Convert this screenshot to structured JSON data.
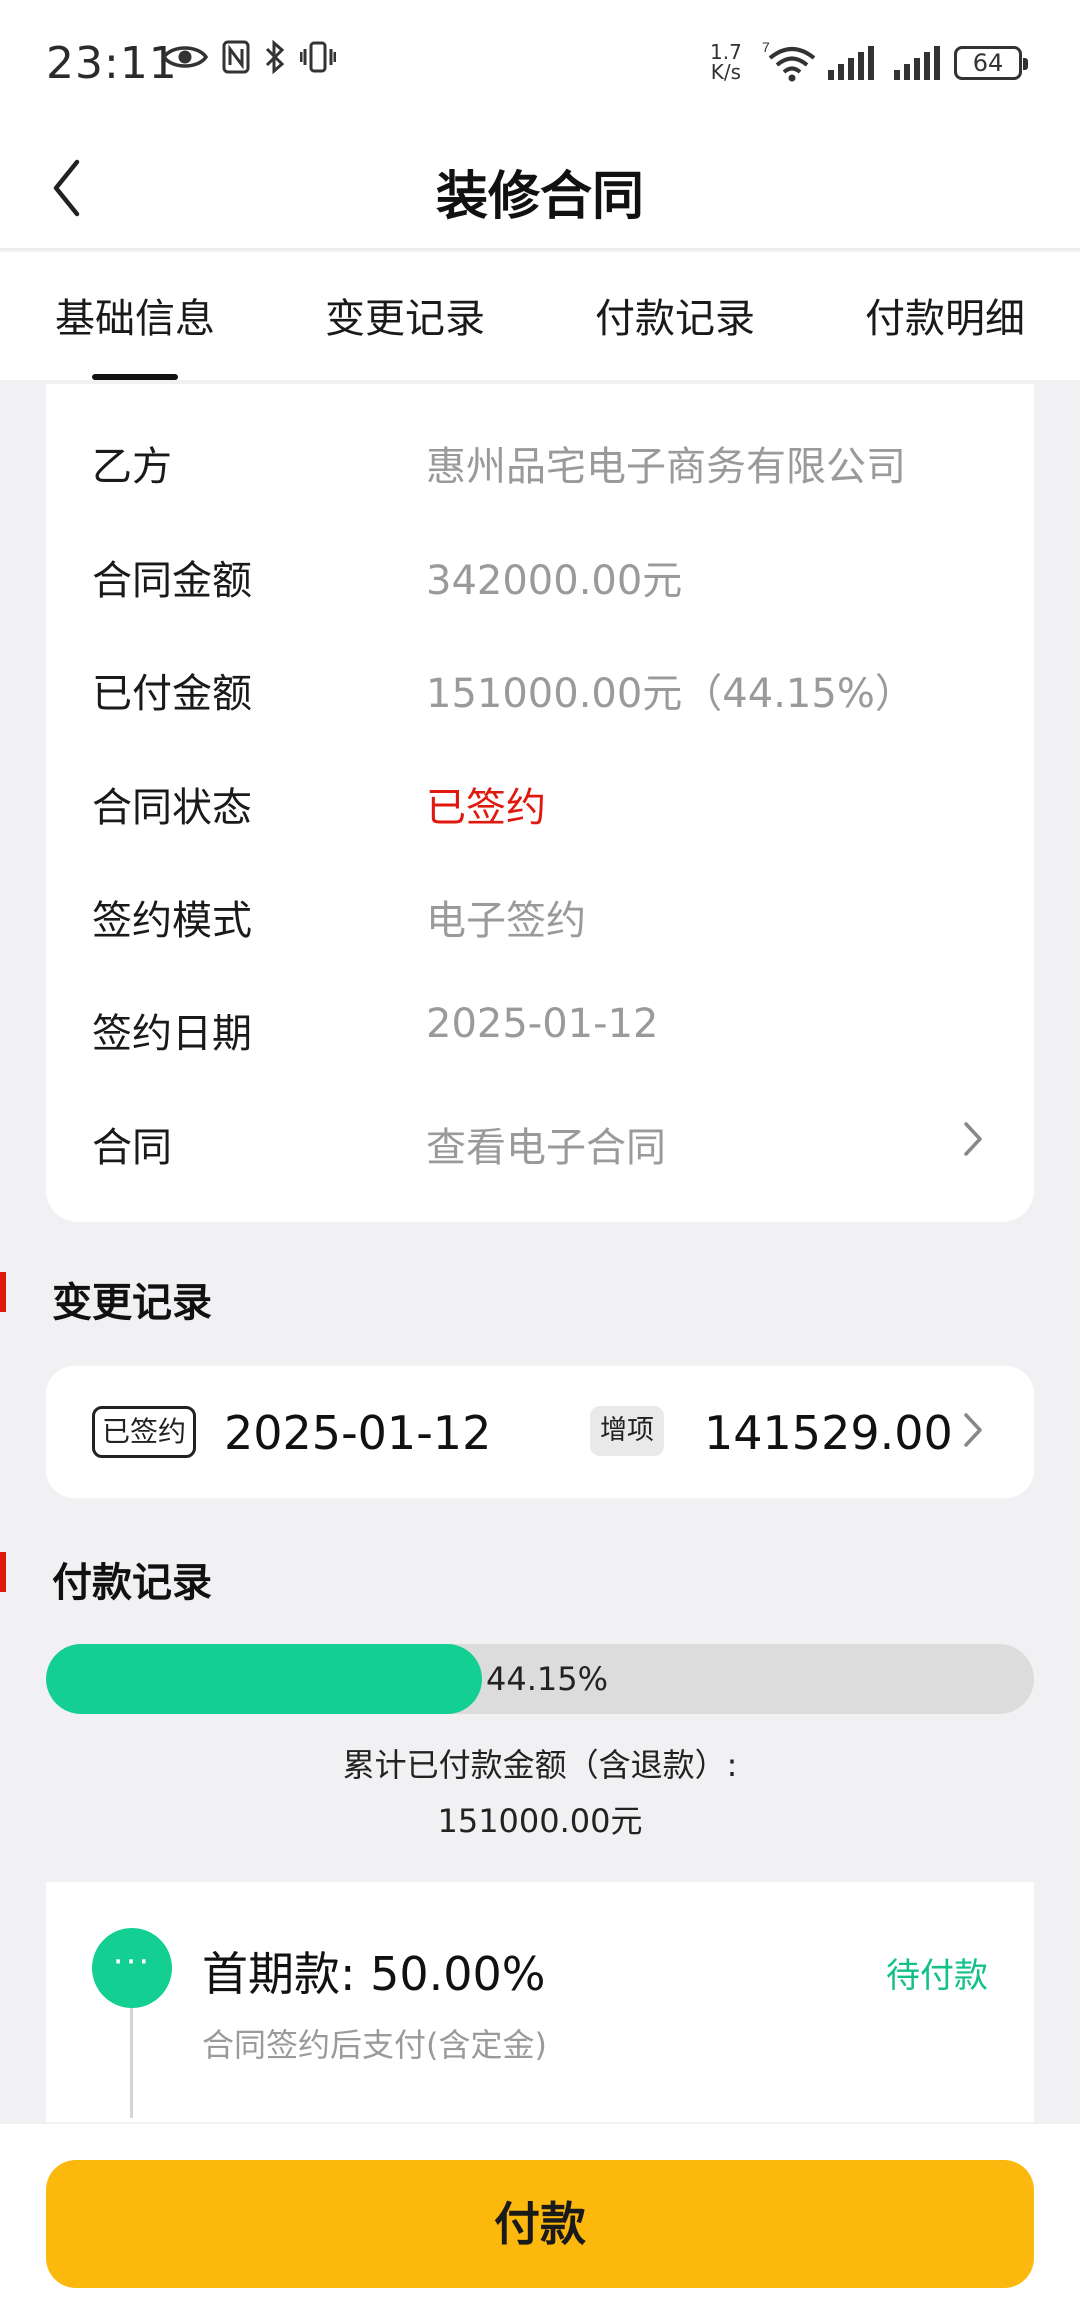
{
  "status_bar": {
    "time": "23:11",
    "net_speed_value": "1.7",
    "net_speed_unit": "K/s",
    "battery": "64"
  },
  "header": {
    "title": "装修合同"
  },
  "tabs": [
    {
      "label": "基础信息",
      "active": true
    },
    {
      "label": "变更记录",
      "active": false
    },
    {
      "label": "付款记录",
      "active": false
    },
    {
      "label": "付款明细",
      "active": false
    }
  ],
  "info": {
    "rows": [
      {
        "label": "乙方",
        "value": "惠州品宅电子商务有限公司"
      },
      {
        "label": "合同金额",
        "value": "342000.00元"
      },
      {
        "label": "已付金额",
        "value": "151000.00元（44.15%）"
      },
      {
        "label": "合同状态",
        "value": "已签约"
      },
      {
        "label": "签约模式",
        "value": "电子签约"
      },
      {
        "label": "签约日期",
        "value": "2025-01-12"
      },
      {
        "label": "合同",
        "value": "查看电子合同"
      }
    ],
    "status_color": "#e0190f"
  },
  "change_section": {
    "title": "变更记录",
    "record": {
      "badge": "已签约",
      "date": "2025-01-12",
      "tag": "增项",
      "amount": "141529.00"
    }
  },
  "payment_section": {
    "title": "付款记录",
    "progress_percent": 44.15,
    "progress_label": "44.15%",
    "paid_title": "累计已付款金额（含退款）:",
    "paid_value": "151000.00元"
  },
  "installment": {
    "dot_icon": "ellipsis-icon",
    "title": "首期款:  50.00%",
    "status": "待付款",
    "description": "合同签约后支付(含定金)"
  },
  "bottom": {
    "pay_label": "付款"
  },
  "colors": {
    "accent_green": "#13cf92",
    "pay_button": "#fdb80e",
    "section_bar": "#e0190f"
  }
}
